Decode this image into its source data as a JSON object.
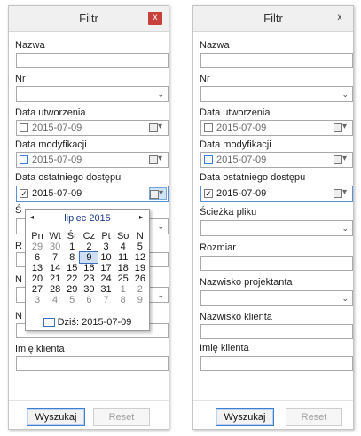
{
  "dialog": {
    "title": "Filtr",
    "close_glyph": "x",
    "close_icon": "close-icon"
  },
  "fields": {
    "nazwa": "Nazwa",
    "nr": "Nr",
    "data_utworzenia": "Data utworzenia",
    "data_modyfikacji": "Data modyfikacji",
    "data_dostepu": "Data ostatniego dostępu",
    "sciezka": "Ścieżka pliku",
    "rozmiar": "Rozmiar",
    "projektant": "Nazwisko projektanta",
    "klient_nazwisko": "Nazwisko klienta",
    "klient_imie": "Imię klienta"
  },
  "left_dates": {
    "utworzenia": {
      "value": "2015-07-09",
      "checked": false
    },
    "modyfikacji": {
      "value": "2015-07-09",
      "checked": false
    },
    "dostepu": {
      "value": "2015-07-09",
      "checked": true
    }
  },
  "right_dates": {
    "utworzenia": {
      "value": "2015-07-09",
      "checked": false
    },
    "modyfikacji": {
      "value": "2015-07-09",
      "checked": false
    },
    "dostepu": {
      "value": "2015-07-09",
      "checked": true
    }
  },
  "left_partial_labels": {
    "s": "Ś",
    "r": "R",
    "n1": "N",
    "n2": "N"
  },
  "calendar": {
    "month": "lipiec 2015",
    "prev": "◂",
    "next": "▸",
    "weekdays": [
      "Pn",
      "Wt",
      "Śr",
      "Cz",
      "Pt",
      "So",
      "N"
    ],
    "weeks": [
      [
        "29",
        "30",
        "1",
        "2",
        "3",
        "4",
        "5"
      ],
      [
        "6",
        "7",
        "8",
        "9",
        "10",
        "11",
        "12"
      ],
      [
        "13",
        "14",
        "15",
        "16",
        "17",
        "18",
        "19"
      ],
      [
        "20",
        "21",
        "22",
        "23",
        "24",
        "25",
        "26"
      ],
      [
        "27",
        "28",
        "29",
        "30",
        "31",
        "1",
        "2"
      ],
      [
        "3",
        "4",
        "5",
        "6",
        "7",
        "8",
        "9"
      ]
    ],
    "selected_day": "9",
    "today_text": "Dziś: 2015-07-09"
  },
  "buttons": {
    "search": "Wyszukaj",
    "reset": "Reset"
  },
  "check_glyph": "✓",
  "chevron_glyph": "⌄"
}
